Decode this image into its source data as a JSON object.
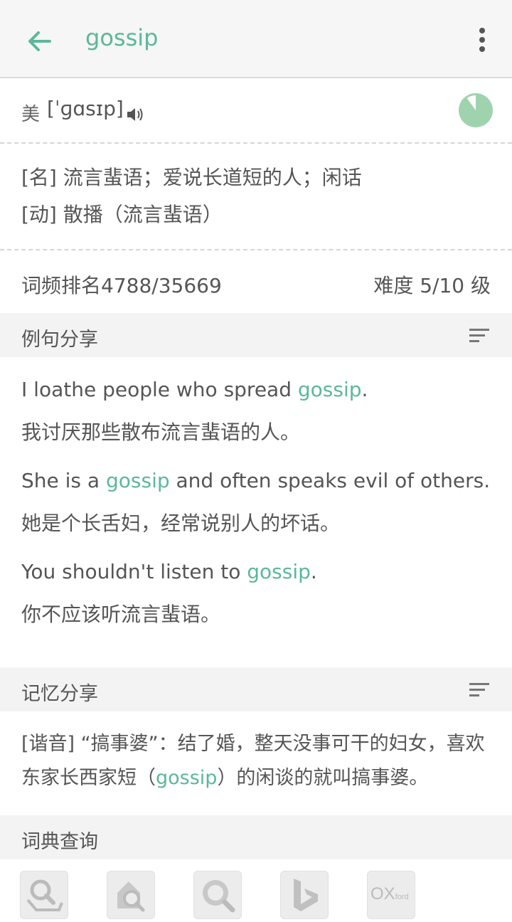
{
  "header": {
    "title": "gossip",
    "back_icon": "arrow-left-icon",
    "menu_icon": "more-vertical-icon"
  },
  "pronunciation": {
    "region": "美",
    "ipa": "[ˈɡɑsɪp]",
    "speaker_icon": "speaker-icon",
    "progress_fraction": 0.1
  },
  "definitions": [
    "[名] 流言蜚语；爱说长道短的人；闲话",
    "[动] 散播（流言蜚语）"
  ],
  "stats": {
    "rank": "词频排名4788/35669",
    "difficulty": "难度 5/10 级"
  },
  "examples_section": {
    "title": "例句分享",
    "sort_icon": "sort-lines-icon",
    "items": [
      {
        "en_before": "I loathe people who spread ",
        "en_word": "gossip",
        "en_after": ".",
        "zh": "我讨厌那些散布流言蜚语的人。"
      },
      {
        "en_before": "She is a ",
        "en_word": "gossip",
        "en_after": " and often speaks evil of others.",
        "zh": "她是个长舌妇，经常说别人的坏话。"
      },
      {
        "en_before": "You shouldn't listen to ",
        "en_word": "gossip",
        "en_after": ".",
        "zh": "你不应该听流言蜚语。"
      }
    ]
  },
  "memory_section": {
    "title": "记忆分享",
    "sort_icon": "sort-lines-icon",
    "text_before": "[谐音] “搞事婆”：结了婚，整天没事可干的妇女，喜欢东家长西家短（",
    "word": "gossip",
    "text_after": "）的闲谈的就叫搞事婆。"
  },
  "dict_section": {
    "title": "词典查询",
    "buttons": [
      {
        "icon": "dictionary-search-icon"
      },
      {
        "icon": "house-search-icon"
      },
      {
        "icon": "magnifier-icon"
      },
      {
        "icon": "bing-icon"
      },
      {
        "icon": "oxford-icon",
        "label": "OX",
        "label_small": "ford"
      }
    ]
  },
  "colors": {
    "accent": "#5bb89a",
    "section_bg": "#f3f3f3",
    "text": "#555555"
  }
}
